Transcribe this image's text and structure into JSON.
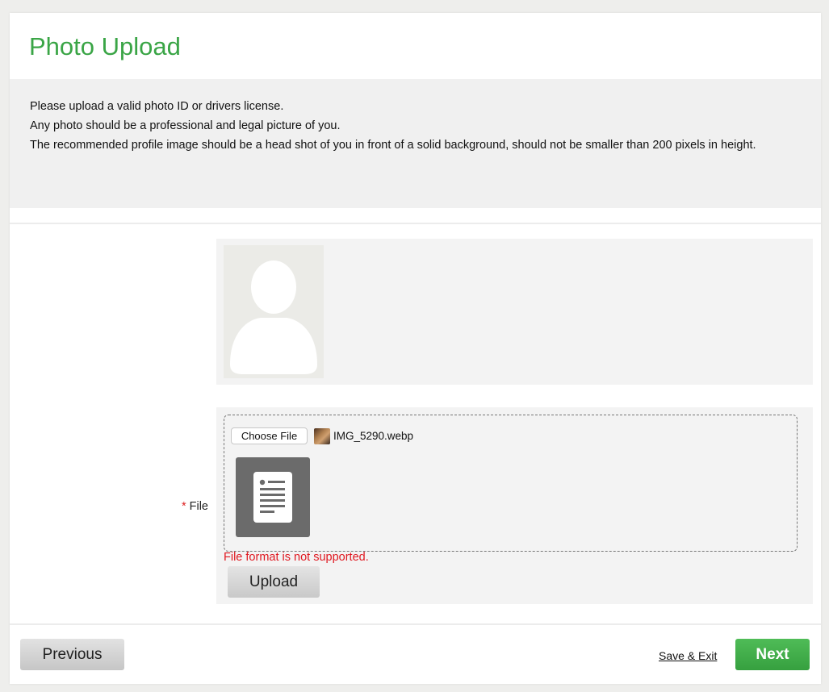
{
  "header": {
    "title": "Photo Upload"
  },
  "instructions": {
    "lines": [
      "Please upload a valid photo ID or drivers license.",
      "Any photo should be a professional and legal picture of you.",
      "The recommended profile image should be a head shot of you in front of a solid background, should not be smaller than 200 pixels in height."
    ]
  },
  "photo": {
    "avatar_icon": "person-silhouette-icon"
  },
  "file_field": {
    "required_marker": "*",
    "label": "File",
    "choose_label": "Choose File",
    "file_name": "IMG_5290.webp",
    "preview_icon": "document-icon",
    "error": "File format is not supported.",
    "upload_label": "Upload"
  },
  "footer": {
    "previous_label": "Previous",
    "save_exit_label": "Save & Exit",
    "next_label": "Next"
  },
  "colors": {
    "accent_green": "#3aa546",
    "error_red": "#e0171f",
    "next_button": "#3ca845"
  }
}
